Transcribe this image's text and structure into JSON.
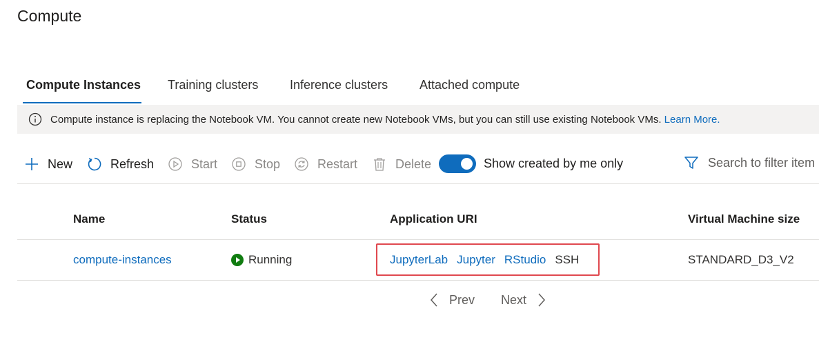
{
  "page": {
    "title": "Compute"
  },
  "tabs": [
    {
      "label": "Compute Instances",
      "active": true
    },
    {
      "label": "Training clusters",
      "active": false
    },
    {
      "label": "Inference clusters",
      "active": false
    },
    {
      "label": "Attached compute",
      "active": false
    }
  ],
  "banner": {
    "message": "Compute instance is replacing the Notebook VM. You cannot create new Notebook VMs, but you can still use existing Notebook VMs.",
    "link": "Learn More."
  },
  "toolbar": {
    "new": "New",
    "refresh": "Refresh",
    "start": "Start",
    "stop": "Stop",
    "restart": "Restart",
    "delete": "Delete",
    "toggle_label": "Show created by me only",
    "toggle_on": true,
    "search_placeholder": "Search to filter item"
  },
  "table": {
    "columns": [
      "Name",
      "Status",
      "Application URI",
      "Virtual Machine size"
    ],
    "rows": [
      {
        "name": "compute-instances",
        "status": "Running",
        "app_links": [
          "JupyterLab",
          "Jupyter",
          "RStudio",
          "SSH"
        ],
        "vm_size": "STANDARD_D3_V2"
      }
    ]
  },
  "pagination": {
    "prev": "Prev",
    "next": "Next"
  },
  "colors": {
    "accent": "#0f6cbd",
    "running": "#107c10",
    "highlight": "#e0484f",
    "banner_bg": "#f3f2f1"
  }
}
